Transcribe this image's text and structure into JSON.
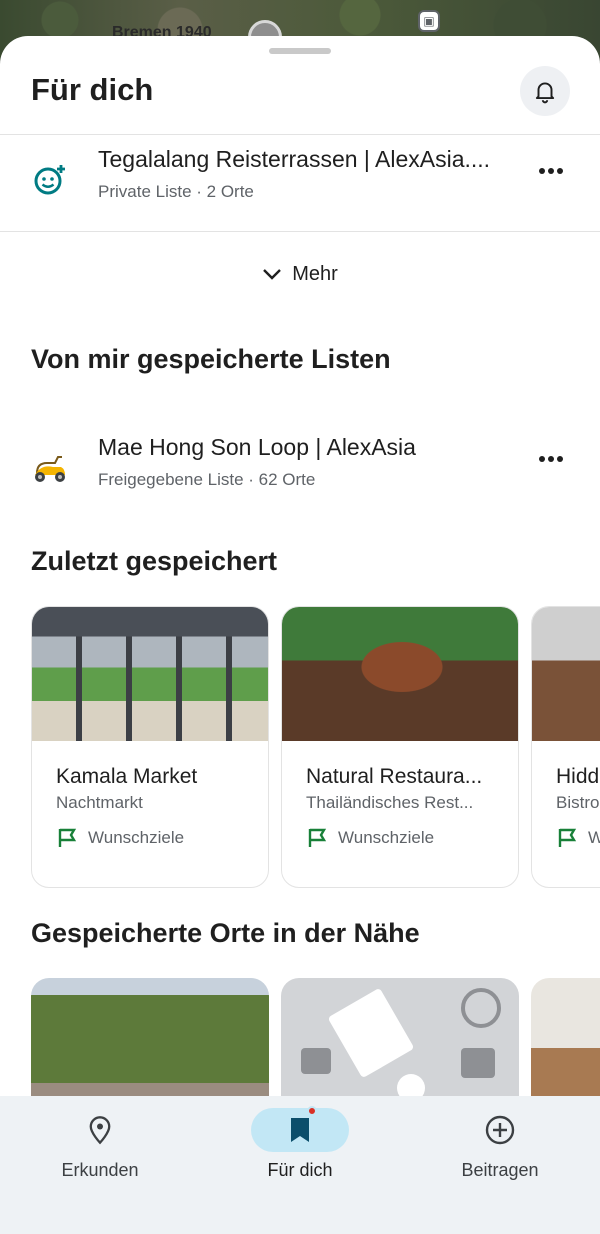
{
  "map": {
    "label": "Bremen 1940"
  },
  "header": {
    "title": "Für dich"
  },
  "top_list": {
    "title": "Tegalalang Reisterrassen | AlexAsia....",
    "subtitle": "Private Liste · 2 Orte",
    "icon": "emoji-add-icon"
  },
  "more": {
    "label": "Mehr"
  },
  "saved_lists": {
    "section_title": "Von mir gespeicherte Listen",
    "items": [
      {
        "title": "Mae Hong Son Loop | AlexAsia",
        "subtitle": "Freigegebene Liste · 62 Orte",
        "icon": "scooter-icon"
      }
    ]
  },
  "recent": {
    "section_title": "Zuletzt gespeichert",
    "cards": [
      {
        "name": "Kamala Market",
        "type": "Nachtmarkt",
        "list": "Wunschziele"
      },
      {
        "name": "Natural Restaura...",
        "type": "Thailändisches Rest...",
        "list": "Wunschziele"
      },
      {
        "name": "Hidd",
        "type": "Bistro",
        "list": "W"
      }
    ]
  },
  "nearby": {
    "section_title": "Gespeicherte Orte in der Nähe"
  },
  "bottom_nav": {
    "items": [
      {
        "label": "Erkunden",
        "icon": "location-pin-icon",
        "active": false
      },
      {
        "label": "Für dich",
        "icon": "bookmark-icon",
        "active": true
      },
      {
        "label": "Beitragen",
        "icon": "add-circle-icon",
        "active": false
      }
    ]
  },
  "colors": {
    "accent": "#c2e7f5",
    "flag_green": "#188038",
    "notification_dot": "#d93025",
    "teal_icon": "#007b83"
  }
}
